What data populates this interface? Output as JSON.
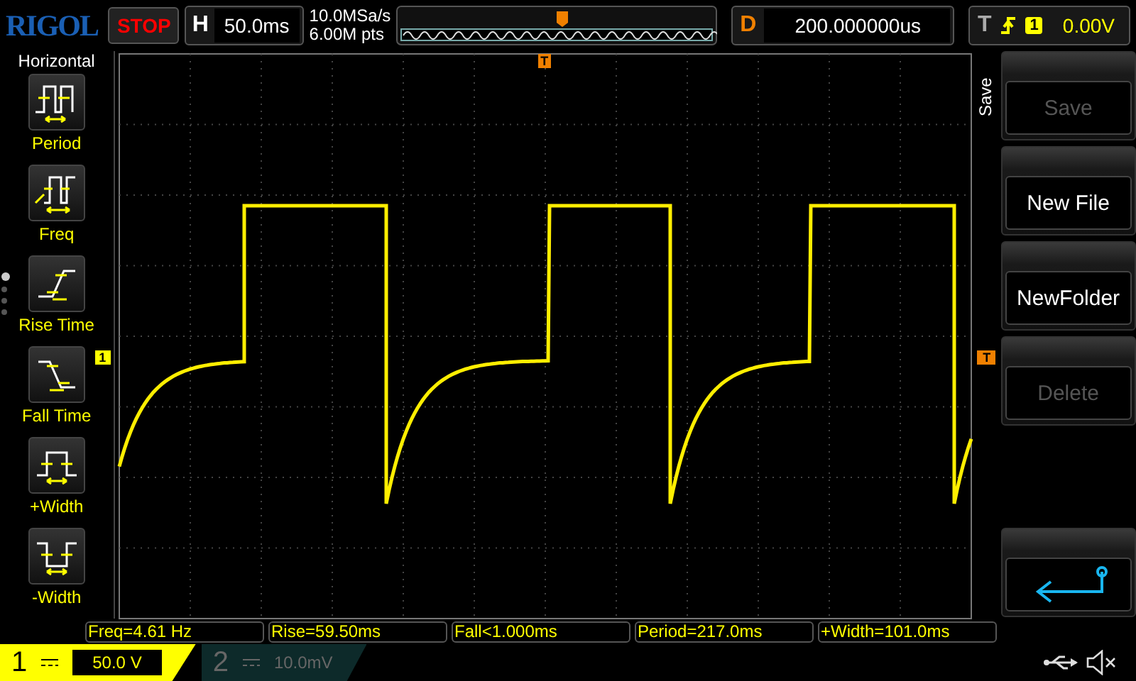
{
  "top_bar": {
    "logo": "RIGOL",
    "run_state": "STOP",
    "horizontal": {
      "label": "H",
      "value": "50.0ms"
    },
    "sample_rate": "10.0MSa/s",
    "memory_depth": "6.00M pts",
    "delay": {
      "label": "D",
      "value": "200.000000us"
    },
    "trigger": {
      "label": "T",
      "source": "1",
      "level": "0.00V"
    }
  },
  "left_menu": {
    "title": "Horizontal",
    "items": [
      {
        "label": "Period",
        "kind": "period"
      },
      {
        "label": "Freq",
        "kind": "freq"
      },
      {
        "label": "Rise Time",
        "kind": "rise"
      },
      {
        "label": "Fall Time",
        "kind": "fall"
      },
      {
        "label": "+Width",
        "kind": "pwidth"
      },
      {
        "label": "-Width",
        "kind": "nwidth"
      }
    ],
    "pages": [
      {
        "selected": true
      },
      {
        "selected": false
      },
      {
        "selected": false
      },
      {
        "selected": false
      }
    ]
  },
  "screen": {
    "trigger_marker": "T",
    "channel_marker": "1",
    "level_marker": "T"
  },
  "right_menu": {
    "title": "Save",
    "buttons": [
      {
        "label": "Save",
        "disabled": true,
        "kind": "text"
      },
      {
        "label": "New File",
        "disabled": false,
        "kind": "text"
      },
      {
        "label": "NewFolder",
        "disabled": false,
        "kind": "text"
      },
      {
        "label": "Delete",
        "disabled": true,
        "kind": "text"
      },
      {
        "kind": "back",
        "disabled": false
      }
    ]
  },
  "measurements": [
    "Freq=4.61 Hz",
    "Rise=59.50ms",
    "Fall<1.000ms",
    "Period=217.0ms",
    "+Width=101.0ms"
  ],
  "channels": [
    {
      "number": "1",
      "scale": "50.0 V",
      "selected": true
    },
    {
      "number": "2",
      "scale": "10.0mV",
      "selected": false
    }
  ]
}
